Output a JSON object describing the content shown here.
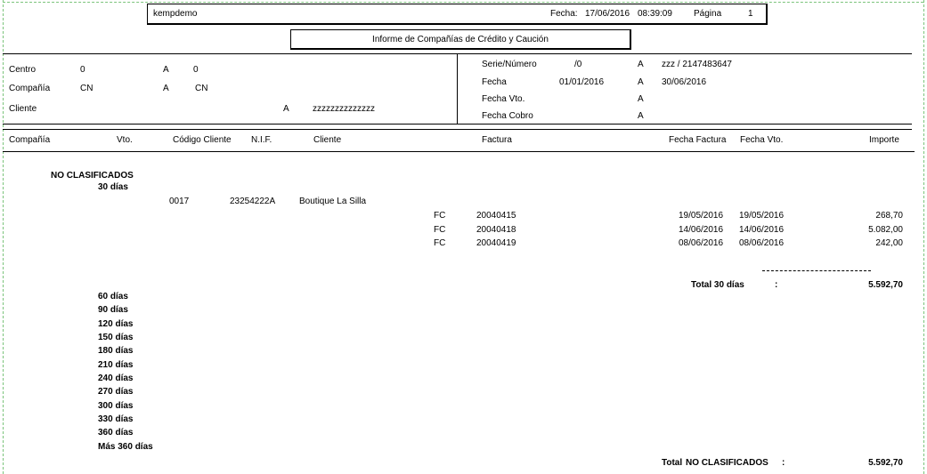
{
  "header": {
    "user": "kempdemo",
    "fecha_label": "Fecha:",
    "fecha": "17/06/2016",
    "hora": "08:39:09",
    "pagina_label": "Página",
    "pagina": "1"
  },
  "report_title": "Informe de Compañías de Crédito y Caución",
  "filters_left": [
    {
      "label": "Centro",
      "from": "0",
      "a": "A",
      "to": "0"
    },
    {
      "label": "Compañía",
      "from": "CN",
      "a": "A",
      "to": "CN"
    },
    {
      "label": "Cliente",
      "from": "",
      "a": "A",
      "to": "zzzzzzzzzzzzzz"
    }
  ],
  "filters_right": [
    {
      "label": "Serie/Número",
      "from": "/0",
      "a": "A",
      "to": "zzz  /  2147483647"
    },
    {
      "label": "Fecha",
      "from": "01/01/2016",
      "a": "A",
      "to": "30/06/2016"
    },
    {
      "label": "Fecha Vto.",
      "from": "",
      "a": "A",
      "to": ""
    },
    {
      "label": "Fecha Cobro",
      "from": "",
      "a": "A",
      "to": ""
    }
  ],
  "columns": [
    "Compañía",
    "Vto.",
    "Código Cliente",
    "N.I.F.",
    "Cliente",
    "Factura",
    "Fecha Factura",
    "Fecha Vto.",
    "Importe"
  ],
  "group": {
    "name": "NO CLASIFICADOS",
    "first_bucket": "30 días",
    "client": {
      "code": "0017",
      "nif": "23254222A",
      "name": "Boutique La Silla"
    },
    "invoices": [
      {
        "serie": "FC",
        "num": "20040415",
        "fecha_factura": "19/05/2016",
        "fecha_vto": "19/05/2016",
        "importe": "268,70"
      },
      {
        "serie": "FC",
        "num": "20040418",
        "fecha_factura": "14/06/2016",
        "fecha_vto": "14/06/2016",
        "importe": "5.082,00"
      },
      {
        "serie": "FC",
        "num": "20040419",
        "fecha_factura": "08/06/2016",
        "fecha_vto": "08/06/2016",
        "importe": "242,00"
      }
    ],
    "subtotal_label": "Total  30 días",
    "subtotal_colon": ":",
    "subtotal": "5.592,70",
    "other_buckets": [
      "60 días",
      "90 días",
      "120 días",
      "150 días",
      "180 días",
      "210 días",
      "240 días",
      "270 días",
      "300 días",
      "330 días",
      "360 días",
      "Más 360 días"
    ],
    "total_label": "Total",
    "total_name": "NO CLASIFICADOS",
    "total_colon": ":",
    "total": "5.592,70"
  }
}
